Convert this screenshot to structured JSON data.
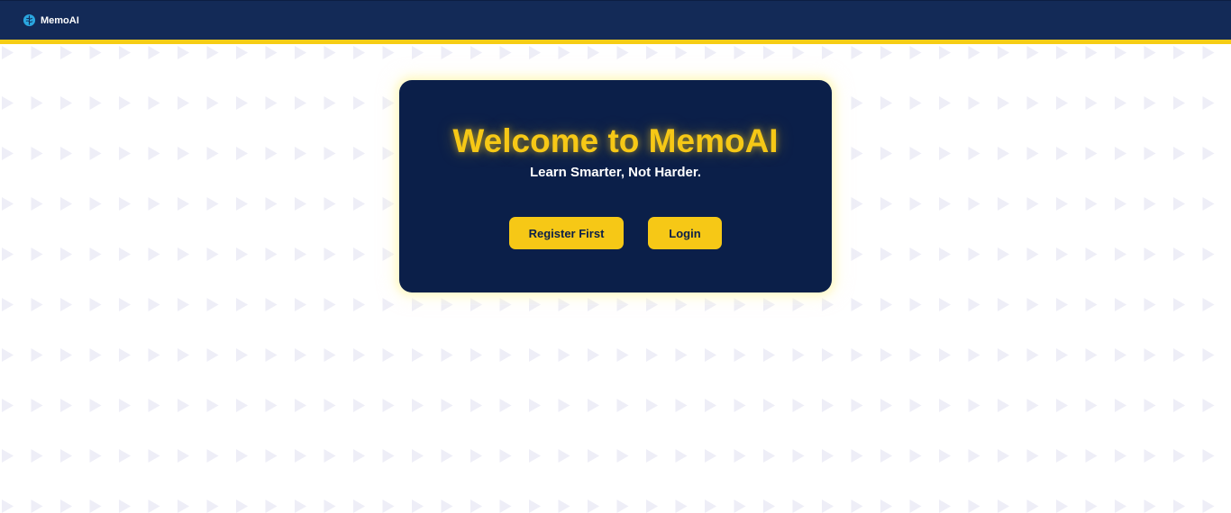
{
  "navbar": {
    "brand_name": "MemoAI",
    "brand_icon": "brain-icon",
    "background": "#132a57",
    "stripe_color": "#f6cd15"
  },
  "hero": {
    "title": "Welcome to MemoAI",
    "subtitle": "Learn Smarter, Not Harder.",
    "card_background": "#0b1f49",
    "title_color": "#f6c816"
  },
  "actions": {
    "register_label": "Register First",
    "login_label": "Login",
    "button_color": "#f6c816"
  },
  "background": {
    "pattern_icon": "triangle-play-icon",
    "pattern_color": "#eeeef7"
  }
}
